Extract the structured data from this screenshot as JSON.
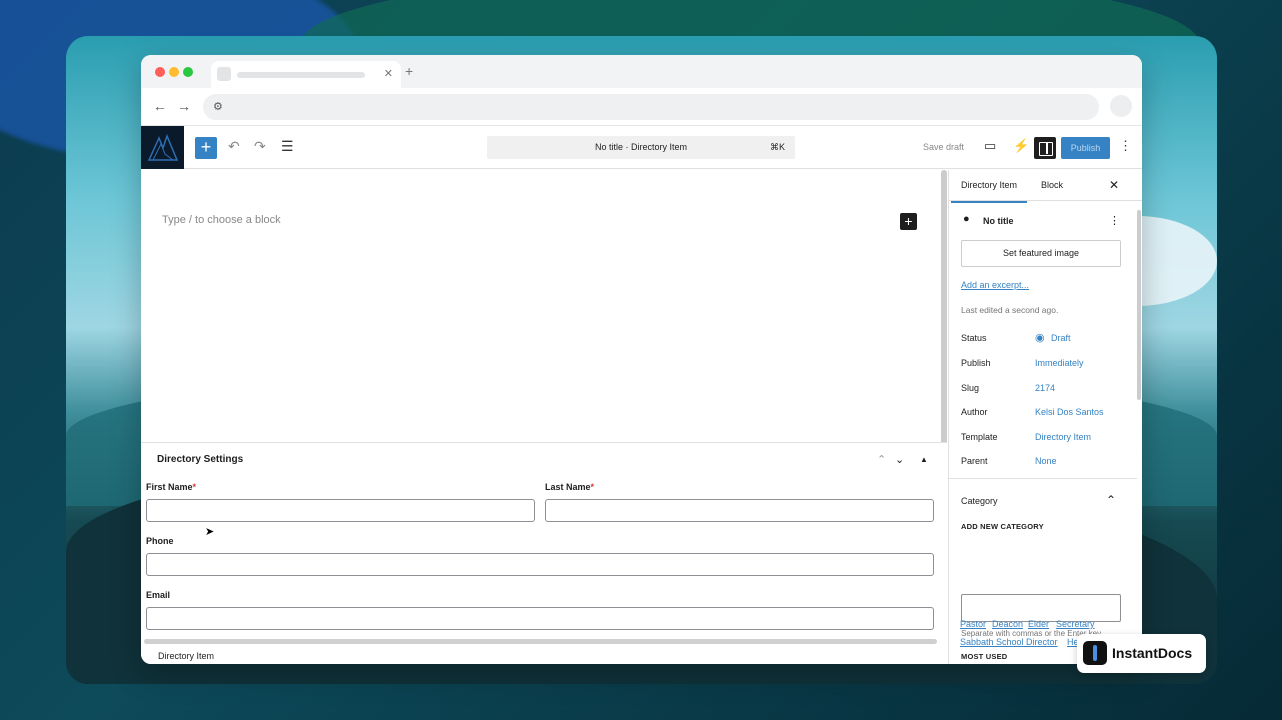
{
  "editor": {
    "doc_title": "No title · Directory Item",
    "shortcut": "⌘K",
    "save_draft": "Save draft",
    "publish": "Publish",
    "placeholder": "Type / to choose a block"
  },
  "meta_box": {
    "title": "Directory Settings",
    "fields": {
      "first_name": "First Name",
      "last_name": "Last Name",
      "phone": "Phone",
      "email": "Email"
    },
    "required_mark": "*",
    "breadcrumb": "Directory Item"
  },
  "sidebar": {
    "tabs": [
      "Directory Item",
      "Block"
    ],
    "post_title": "No title",
    "featured_image_button": "Set featured image",
    "excerpt_link": "Add an excerpt...",
    "last_edited": "Last edited a second ago.",
    "rows": [
      {
        "label": "Status",
        "value": "Draft"
      },
      {
        "label": "Publish",
        "value": "Immediately"
      },
      {
        "label": "Slug",
        "value": "2174"
      },
      {
        "label": "Author",
        "value": "Kelsi Dos Santos"
      },
      {
        "label": "Template",
        "value": "Directory Item"
      },
      {
        "label": "Parent",
        "value": "None"
      }
    ],
    "category": {
      "title": "Category",
      "add_new_label": "ADD NEW CATEGORY",
      "hint": "Separate with commas or the Enter key.",
      "most_used_label": "MOST USED",
      "tags_line1": [
        "Pastor",
        "Deacon",
        "Elder",
        "Secretary"
      ],
      "tags_line2": [
        "Sabbath School Director",
        "He"
      ]
    }
  },
  "badge": {
    "text": "InstantDocs"
  }
}
